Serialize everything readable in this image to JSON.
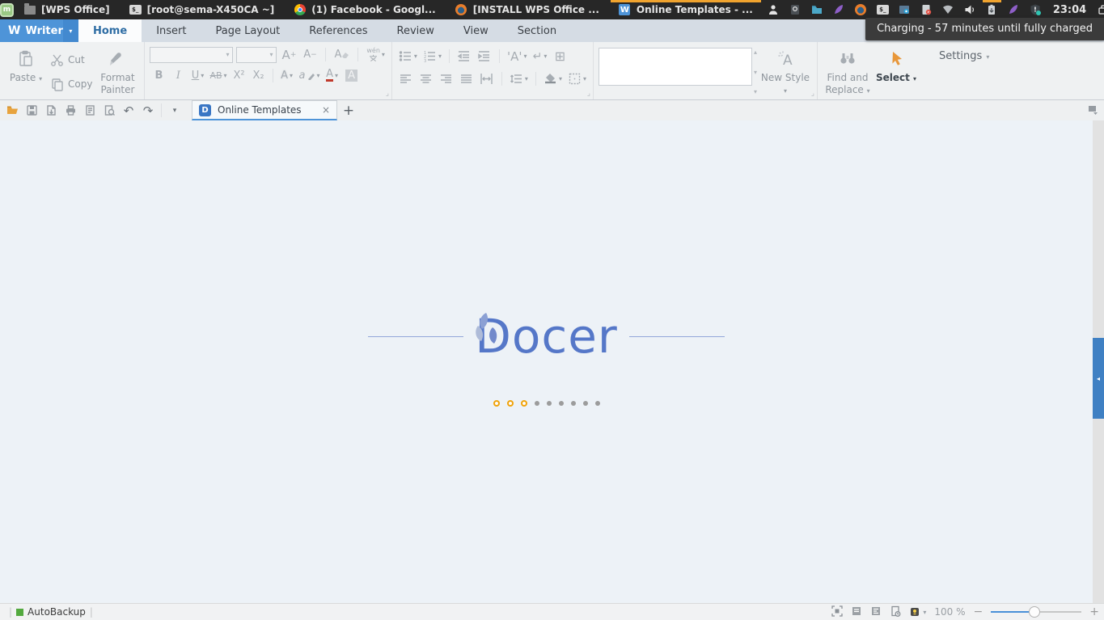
{
  "colors": {
    "writer_blue": "#4e94d8",
    "active_indicator_orange": "#f0a32e",
    "docer_blue": "#5577c8",
    "slider_blue": "#4a90d8",
    "autobackup_green": "#53a93f",
    "panel_bg": "#272727"
  },
  "panel": {
    "tasks": [
      {
        "label": "[WPS Office]",
        "icon": "folder-icon",
        "active": false
      },
      {
        "label": "[root@sema-X450CA ~]",
        "icon": "terminal-icon",
        "active": false
      },
      {
        "label": "(1) Facebook - Googl...",
        "icon": "chrome-icon",
        "active": false
      },
      {
        "label": "[INSTALL WPS Office ...",
        "icon": "firefox-icon",
        "active": false
      },
      {
        "label": "Online Templates - ...",
        "icon": "wps-icon",
        "active": true
      }
    ],
    "tray_icons": [
      "user-icon",
      "package-icon",
      "file-manager-icon",
      "feather-icon",
      "firefox-icon",
      "terminal-icon",
      "screenshot-icon",
      "notes-icon",
      "wifi-icon",
      "volume-icon",
      "battery-icon",
      "feather-icon-2",
      "security-icon"
    ],
    "battery_hovered": true,
    "clock": "23:04",
    "tooltip": "Charging - 57 minutes until fully charged"
  },
  "titlebar": {
    "app_name": "Writer",
    "tabs": [
      {
        "label": "Home",
        "active": true
      },
      {
        "label": "Insert",
        "active": false
      },
      {
        "label": "Page Layout",
        "active": false
      },
      {
        "label": "References",
        "active": false
      },
      {
        "label": "Review",
        "active": false
      },
      {
        "label": "View",
        "active": false
      },
      {
        "label": "Section",
        "active": false
      }
    ]
  },
  "ribbon": {
    "clipboard": {
      "paste": "Paste",
      "cut": "Cut",
      "copy": "Copy",
      "format_painter_1": "Format",
      "format_painter_2": "Painter"
    },
    "font": {
      "name_value": "",
      "size_value": "",
      "grow": "A",
      "grow_sign": "+",
      "shrink": "A",
      "shrink_sign": "−",
      "clear": "A",
      "phonetic_top": "wén",
      "bold": "B",
      "italic": "I",
      "underline": "U",
      "strikethrough": "AB",
      "superscript": "X²",
      "subscript": "X₂",
      "effect": "A",
      "highlight_glyph": "a",
      "color": "A",
      "shading_box": "A"
    },
    "styles": {
      "gallery_value": "",
      "new_style": "New Style"
    },
    "editing": {
      "find_replace_1": "Find and",
      "find_replace_2": "Replace",
      "select": "Select"
    },
    "settings": "Settings"
  },
  "doctabs": {
    "active_tab_title": "Online Templates",
    "docer_badge": "D",
    "close_glyph": "×",
    "new_tab_glyph": "+"
  },
  "canvas": {
    "logo_text": "Docer",
    "dots_total": 9,
    "dots_active": 3
  },
  "statusbar": {
    "autobackup_label": "AutoBackup",
    "zoom_label": "100 %",
    "zoom_minus": "−",
    "zoom_plus": "+",
    "zoom_percent": 100
  }
}
